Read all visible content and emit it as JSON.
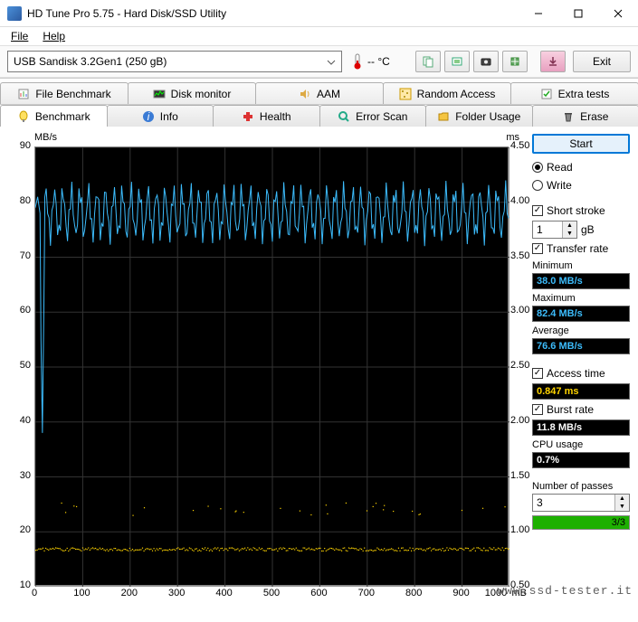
{
  "window": {
    "title": "HD Tune Pro 5.75 - Hard Disk/SSD Utility"
  },
  "menubar": {
    "file": "File",
    "help": "Help"
  },
  "toolbar": {
    "drive": "USB Sandisk 3.2Gen1 (250 gB)",
    "temp": "-- °C",
    "exit": "Exit"
  },
  "tabs_upper": [
    {
      "label": "File Benchmark"
    },
    {
      "label": "Disk monitor"
    },
    {
      "label": "AAM"
    },
    {
      "label": "Random Access"
    },
    {
      "label": "Extra tests"
    }
  ],
  "tabs_lower": [
    {
      "label": "Benchmark"
    },
    {
      "label": "Info"
    },
    {
      "label": "Health"
    },
    {
      "label": "Error Scan"
    },
    {
      "label": "Folder Usage"
    },
    {
      "label": "Erase"
    }
  ],
  "side": {
    "start": "Start",
    "read": "Read",
    "write": "Write",
    "short_stroke": "Short stroke",
    "short_stroke_value": "1",
    "short_stroke_unit": "gB",
    "transfer_rate": "Transfer rate",
    "minimum_label": "Minimum",
    "minimum": "38.0 MB/s",
    "maximum_label": "Maximum",
    "maximum": "82.4 MB/s",
    "average_label": "Average",
    "average": "76.6 MB/s",
    "access_time_label": "Access time",
    "access_time": "0.847 ms",
    "burst_label": "Burst rate",
    "burst": "11.8 MB/s",
    "cpu_label": "CPU usage",
    "cpu": "0.7%",
    "passes_label": "Number of passes",
    "passes_value": "3",
    "progress_label": "3/3",
    "progress_pct": 100
  },
  "chart_data": {
    "type": "line",
    "title": "",
    "xlabel": "mB",
    "ylabel_left": "MB/s",
    "ylabel_right": "ms",
    "xlim": [
      0,
      1000
    ],
    "ylim_left": [
      10,
      90
    ],
    "ylim_right": [
      0.5,
      4.5
    ],
    "x_ticks": [
      0,
      100,
      200,
      300,
      400,
      500,
      600,
      700,
      800,
      900,
      1000
    ],
    "y_ticks_left": [
      10,
      20,
      30,
      40,
      50,
      60,
      70,
      80,
      90
    ],
    "y_ticks_right": [
      0.5,
      1.0,
      1.5,
      2.0,
      2.5,
      3.0,
      3.5,
      4.0,
      4.5
    ],
    "series": [
      {
        "name": "Transfer rate (MB/s)",
        "axis": "left",
        "color": "#3cbcfc",
        "summary": {
          "min": 38.0,
          "max": 82.4,
          "avg": 76.6
        },
        "note": "Oscillates roughly between 73 and 82 MB/s continuously across 0–1000 mB, with an initial drop to ~38 MB/s near x≈15.",
        "x": [
          0,
          5,
          10,
          12,
          15,
          18,
          20,
          25,
          30,
          40,
          50,
          60,
          70,
          80,
          90,
          100,
          120,
          140,
          160,
          180,
          200,
          220,
          240,
          260,
          280,
          300,
          320,
          340,
          360,
          380,
          400,
          420,
          440,
          460,
          480,
          500,
          520,
          540,
          560,
          580,
          600,
          620,
          640,
          660,
          680,
          700,
          720,
          740,
          760,
          780,
          800,
          820,
          840,
          860,
          880,
          900,
          920,
          940,
          960,
          980,
          1000
        ],
        "values": [
          79,
          81,
          78,
          55,
          38,
          60,
          78,
          82,
          74,
          80,
          75,
          81,
          74,
          80,
          76,
          82,
          74,
          81,
          75,
          80,
          74,
          82,
          75,
          80,
          74,
          81,
          76,
          82,
          74,
          80,
          75,
          81,
          74,
          82,
          76,
          80,
          74,
          81,
          75,
          80,
          74,
          82,
          76,
          80,
          74,
          81,
          75,
          82,
          74,
          80,
          75,
          81,
          74,
          82,
          76,
          80,
          74,
          81,
          75,
          80,
          78
        ]
      },
      {
        "name": "Access time (ms)",
        "axis": "right",
        "color": "#ffd400",
        "summary": {
          "avg": 0.847
        },
        "note": "Dense scatter of points forming a thin band near 0.83–0.86 ms across the full range, sparse outliers up to ~1.25 ms.",
        "band_low": 0.83,
        "band_high": 0.86,
        "outliers_ms": [
          1.25,
          1.2,
          1.22,
          1.18,
          1.15
        ]
      }
    ]
  },
  "watermark": "www.ssd-tester.it"
}
